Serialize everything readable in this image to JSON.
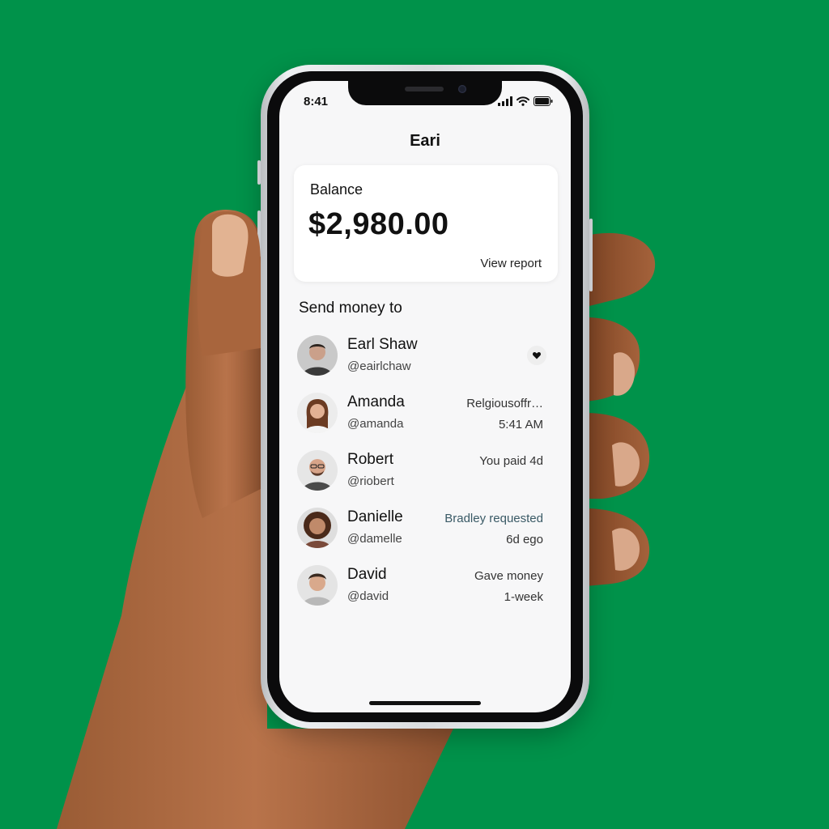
{
  "device": {
    "status_time": "8:41",
    "icons": [
      "signal-icon",
      "wifi-icon",
      "battery-icon"
    ]
  },
  "app": {
    "title": "Eari"
  },
  "balance": {
    "label": "Balance",
    "amount": "$2,980.00",
    "view_report_label": "View report"
  },
  "send_money": {
    "title": "Send money to",
    "contacts": [
      {
        "name": "Earl Shaw",
        "handle": "@eairlchaw",
        "meta1": "",
        "meta2": "",
        "action_icon": "heart-icon"
      },
      {
        "name": "Amanda",
        "handle": "@amanda",
        "meta1": "Relgiousoffr…",
        "meta2": "5:41 AM"
      },
      {
        "name": "Robert",
        "handle": "@riobert",
        "meta1": "You paid 4d",
        "meta2": ""
      },
      {
        "name": "Danielle",
        "handle": "@damelle",
        "meta1": "Bradley requested",
        "meta2": "6d ego"
      },
      {
        "name": "David",
        "handle": "@david",
        "meta1": "Gave money",
        "meta2": "1-week"
      }
    ]
  },
  "colors": {
    "background": "#00924a",
    "screen": "#f7f7f8",
    "card": "#ffffff",
    "text": "#111111",
    "accent_text": "#3a5a66"
  }
}
